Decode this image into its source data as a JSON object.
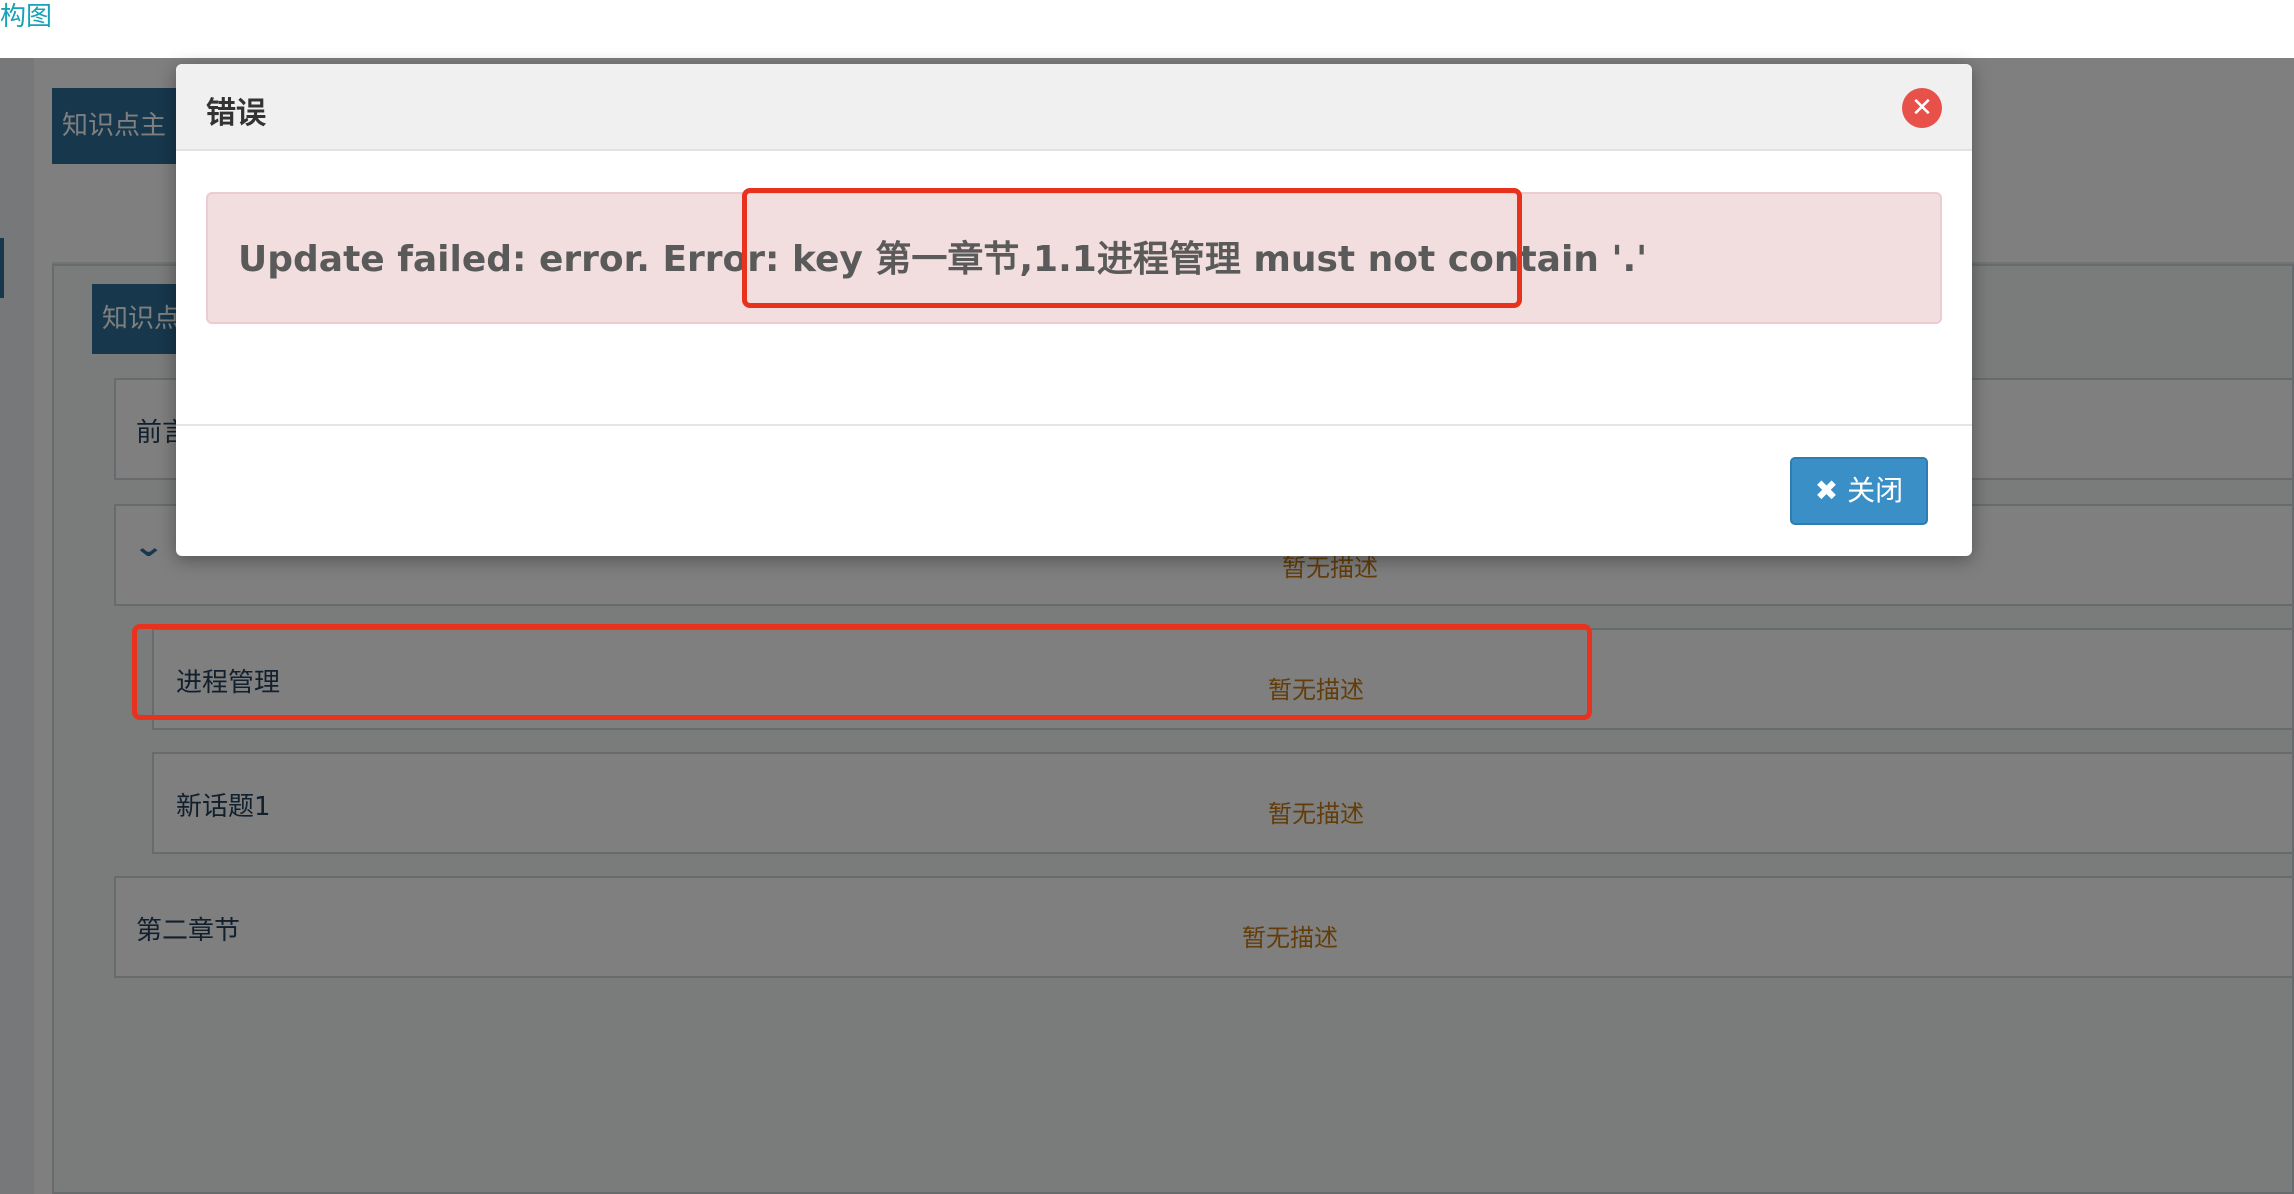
{
  "topbar": {
    "link_text": "构图"
  },
  "page": {
    "outer_tab_label": "知识点主",
    "inner_tab_label": "知识点",
    "rows": [
      {
        "title": "前言",
        "description": ""
      },
      {
        "title": "",
        "description": "暂无描述"
      },
      {
        "title": "进程管理",
        "description": "暂无描述"
      },
      {
        "title": "新话题1",
        "description": "暂无描述"
      },
      {
        "title": "第二章节",
        "description": "暂无描述"
      }
    ],
    "icons": {
      "expand": "chevron-down-icon"
    }
  },
  "modal": {
    "title": "错误",
    "close_icon": "times-circle-icon",
    "message": "Update failed: error. Error: key 第一章节,1.1进程管理 must not contain '.'",
    "button_icon": "times-icon",
    "button_label": "关闭"
  },
  "colors": {
    "primary_button": "#3a8fc7",
    "alert_bg": "#f2dede",
    "description_text": "#c77a12",
    "highlight": "#e8321e",
    "tab_bg": "#2f6f99"
  }
}
